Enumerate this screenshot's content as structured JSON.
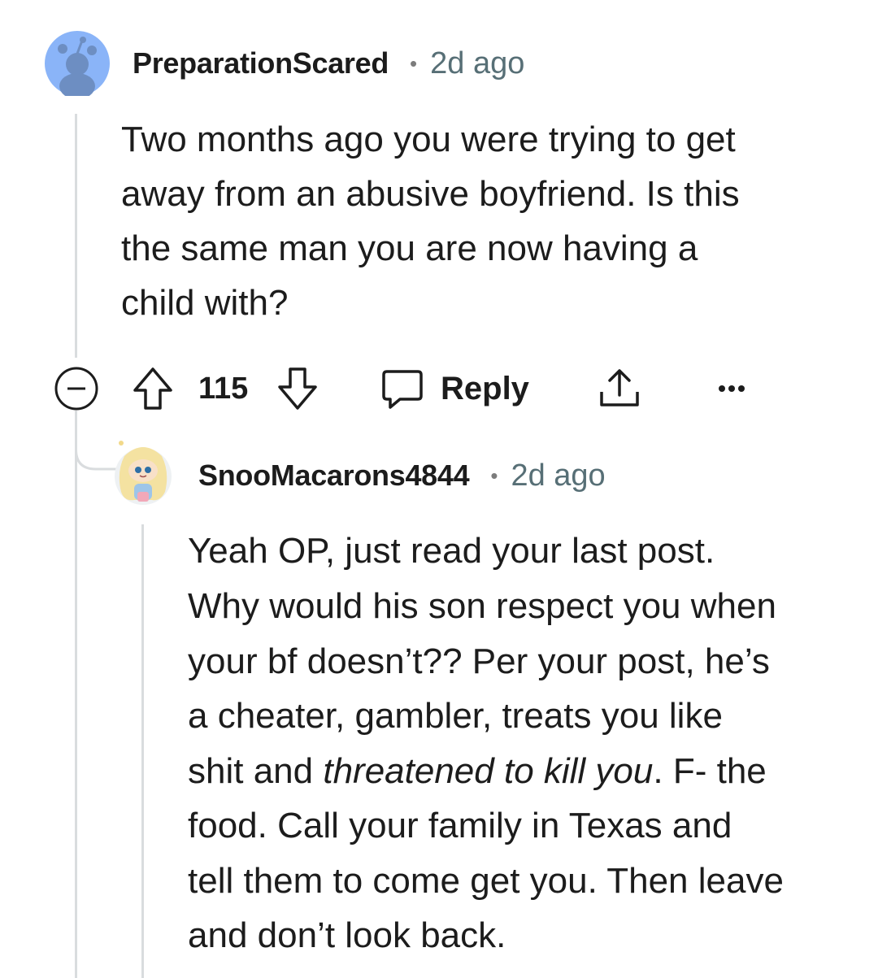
{
  "comments": [
    {
      "username": "PreparationScared",
      "separator": "•",
      "time": "2d ago",
      "body_lines": [
        "Two months ago you were trying to get",
        "away from an abusive boyfriend. Is this",
        "the same man you are now having a",
        "child with?"
      ],
      "score": "115",
      "reply_label": "Reply",
      "avatar_icon": "snoo-default-avatar-icon"
    },
    {
      "username": "SnooMacarons4844",
      "separator": "•",
      "time": "2d ago",
      "body_lines": {
        "l1": "Yeah OP, just read your last post.",
        "l2": "Why would his son respect you when",
        "l3": "your bf doesn’t?? Per your post, he’s",
        "l4": "a cheater, gambler, treats you like",
        "l5_pre": "shit and ",
        "l5_em": "threatened to kill you",
        "l5_post": ". F- the",
        "l6": "food. Call your family in Texas and",
        "l7": "tell them to come get you. Then leave",
        "l8": "and don’t look back."
      },
      "avatar_icon": "snoo-custom-avatar-icon"
    }
  ],
  "colors": {
    "avatar_bg": "#8ab4f8",
    "thread_line": "#d9dcde",
    "meta_gray": "#576f76",
    "text": "#1c1c1c"
  }
}
